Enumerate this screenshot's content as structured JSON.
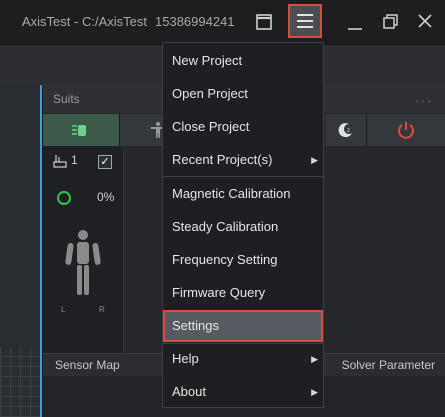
{
  "window": {
    "title": "AxisTest - C:/AxisTest",
    "phone": "15386994241"
  },
  "suits_panel": {
    "title": "Suits",
    "more_label": "...",
    "suit_number": "1",
    "progress_label": "0%",
    "avatar_labels": {
      "left": "L",
      "right": "R"
    },
    "bottom_tabs": {
      "sensor_map": "Sensor Map",
      "solver_parameter": "Solver Parameter"
    }
  },
  "menu": {
    "items": [
      {
        "label": "New Project",
        "has_submenu": false
      },
      {
        "label": "Open Project",
        "has_submenu": false
      },
      {
        "label": "Close Project",
        "has_submenu": false
      },
      {
        "label": "Recent Project(s)",
        "has_submenu": true
      },
      {
        "label": "Magnetic Calibration",
        "has_submenu": false
      },
      {
        "label": "Steady Calibration",
        "has_submenu": false
      },
      {
        "label": "Frequency Setting",
        "has_submenu": false
      },
      {
        "label": "Firmware Query",
        "has_submenu": false
      },
      {
        "label": "Settings",
        "has_submenu": false
      },
      {
        "label": "Help",
        "has_submenu": true
      },
      {
        "label": "About",
        "has_submenu": true
      }
    ],
    "submenu_arrow": "▶"
  },
  "colors": {
    "highlight_border": "#e04a3a",
    "viewport_edge": "#3aa0e0",
    "status_ok": "#33c04a",
    "power_icon": "#e04a3a"
  }
}
